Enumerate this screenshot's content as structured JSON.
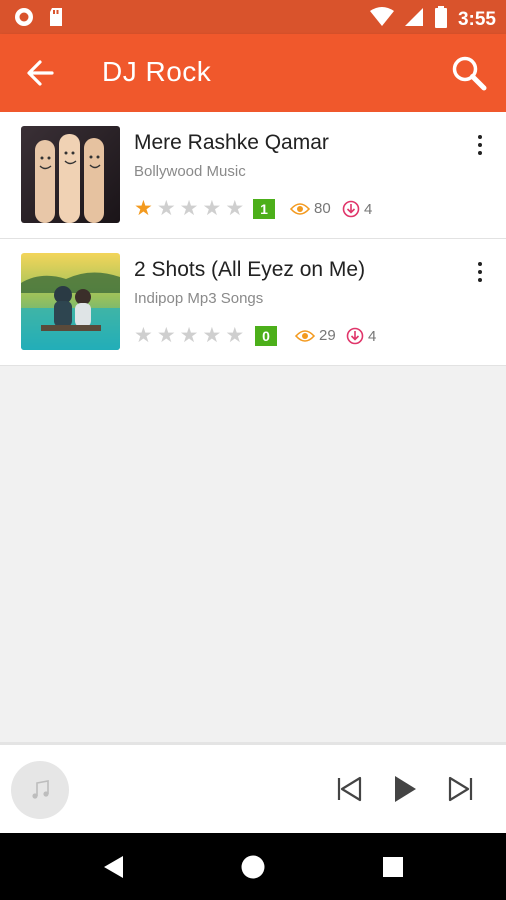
{
  "status_bar": {
    "time": "3:55"
  },
  "app_bar": {
    "title": "DJ Rock"
  },
  "songs": [
    {
      "title": "Mere Rashke Qamar",
      "category": "Bollywood Music",
      "rating": 1,
      "rating_badge": "1",
      "views": "80",
      "downloads": "4"
    },
    {
      "title": "2 Shots (All Eyez on Me)",
      "category": "Indipop Mp3 Songs",
      "rating": 0,
      "rating_badge": "0",
      "views": "29",
      "downloads": "4"
    }
  ],
  "colors": {
    "accent": "#f0582c",
    "status_bar": "#d9532c",
    "star_on": "#f39a1f",
    "badge": "#4caf1a",
    "views_icon": "#f39a1f",
    "download_icon": "#e0356a"
  }
}
